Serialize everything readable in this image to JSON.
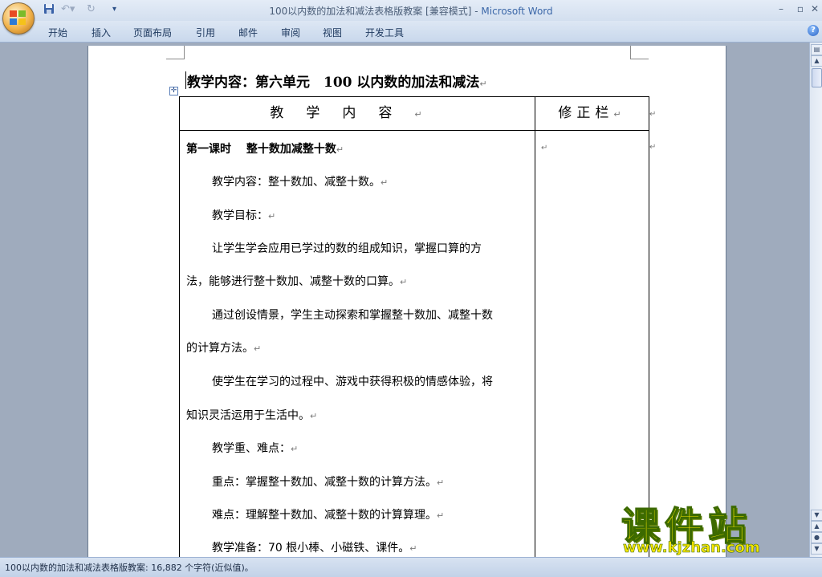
{
  "window": {
    "title_doc": "100以内数的加法和减法表格版教案 [兼容模式] - ",
    "title_app": "Microsoft Word"
  },
  "quick_access": {
    "save_icon": "save-icon",
    "undo_icon": "undo-icon",
    "redo_icon": "redo-icon",
    "customize_icon": "qat-dropdown-icon"
  },
  "ribbon": {
    "tabs": [
      "开始",
      "插入",
      "页面布局",
      "引用",
      "邮件",
      "审阅",
      "视图",
      "开发工具"
    ]
  },
  "document": {
    "heading": "教学内容：第六单元　100 以内数的加法和减法",
    "table": {
      "header_content": "教学内容",
      "header_note": "修正栏",
      "paragraphs": [
        "第一课时　 整十数加减整十数",
        "教学内容：整十数加、减整十数。",
        "教学目标：",
        "让学生学会应用已学过的数的组成知识，掌握口算的方",
        "法，能够进行整十数加、减整十数的口算。",
        "通过创设情景，学生主动探索和掌握整十数加、减整十数",
        "的计算方法。",
        "使学生在学习的过程中、游戏中获得积极的情感体验，将",
        "知识灵活运用于生活中。",
        "教学重、难点：",
        "重点：掌握整十数加、减整十数的计算方法。",
        "难点：理解整十数加、减整十数的计算算理。",
        "教学准备：70 根小棒、小磁铁、课件。"
      ]
    },
    "paragraph_mark": "↵"
  },
  "status": {
    "text": "100以内数的加法和减法表格版教案: 16,882 个字符(近似值)。"
  },
  "watermark": {
    "cn": "课件站",
    "url": "www.kjzhan.com"
  },
  "colors": {
    "ribbon_bg": "#d3dfef",
    "workspace_bg": "#9fabbd",
    "app_name": "#3b67a8",
    "watermark_fill": "#f7e600"
  }
}
